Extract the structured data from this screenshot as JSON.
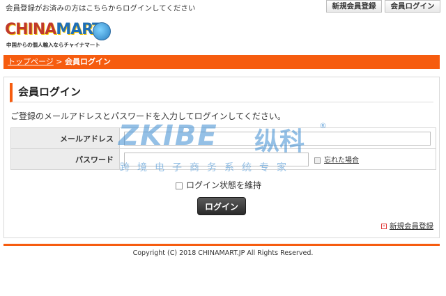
{
  "topbar": {
    "notice": "会員登録がお済みの方はこちらからログインしてください",
    "register_button": "新規会員登録",
    "login_button": "会員ログイン"
  },
  "logo": {
    "name_left": "CHINA",
    "name_right": "MART",
    "tagline": "中国からの個人輸入ならチャイナマート"
  },
  "breadcrumb": {
    "home": "トップページ",
    "separator": " > ",
    "current": "会員ログイン"
  },
  "login": {
    "heading": "会員ログイン",
    "intro": "ご登録のメールアドレスとパスワードを入力してログインしてください。",
    "email_label": "メールアドレス",
    "email_value": "",
    "password_label": "パスワード",
    "password_value": "",
    "forgot_link": "忘れた場合",
    "keep_login_label": "ログイン状態を維持",
    "keep_login_checked": false,
    "submit_label": "ログイン",
    "new_register_link": "新規会員登録"
  },
  "footer": {
    "copyright": "Copyright (C) 2018 CHINAMART.JP All Rights Reserved."
  },
  "watermark": {
    "brand": "ZKIBE",
    "brand_cn": "纵科",
    "registered": "®",
    "subtitle": "跨境电子商务系统专家"
  },
  "colors": {
    "accent": "#f65c0f",
    "button_dark": "#2a2a2a",
    "watermark": "#3c8cd2"
  }
}
